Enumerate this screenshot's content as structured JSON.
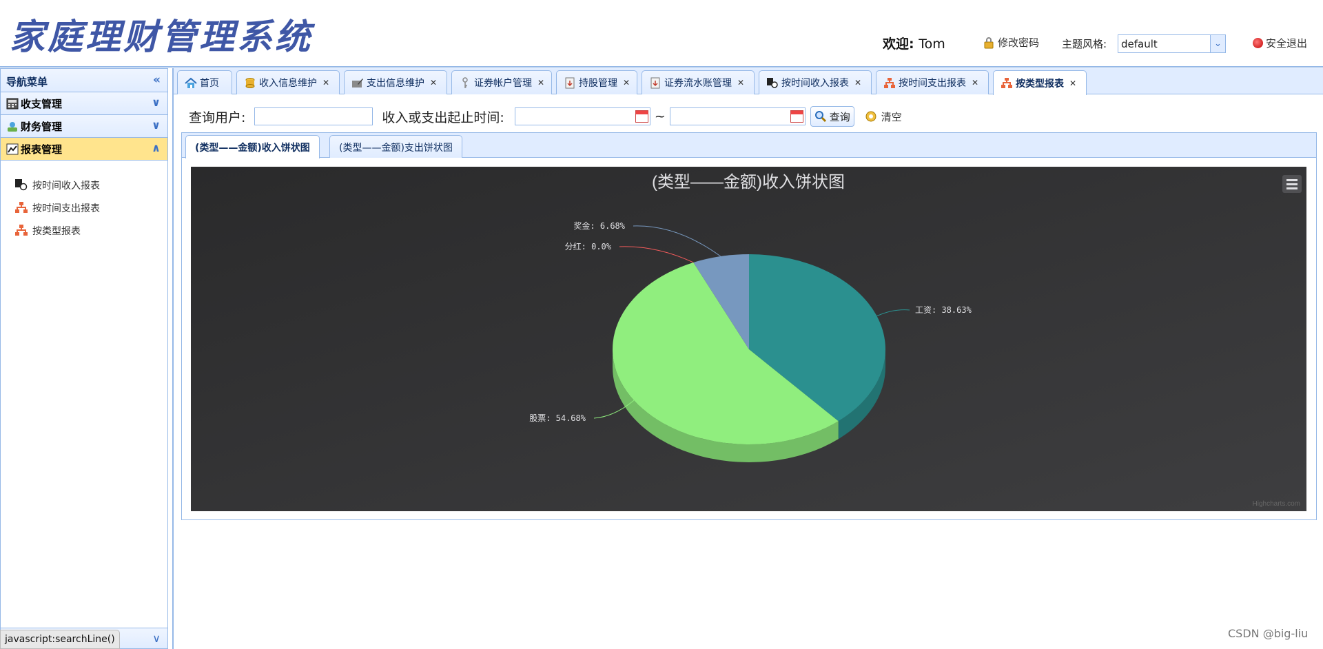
{
  "header": {
    "logo": "家庭理财管理系统",
    "welcome_label": "欢迎:",
    "welcome_user": "Tom",
    "change_password": "修改密码",
    "theme_label": "主题风格:",
    "theme_value": "default",
    "logout": "安全退出"
  },
  "sidebar": {
    "title": "导航菜单",
    "sections": [
      {
        "label": "收支管理"
      },
      {
        "label": "财务管理"
      },
      {
        "label": "报表管理"
      }
    ],
    "items": [
      {
        "label": "按时间收入报表"
      },
      {
        "label": "按时间支出报表"
      },
      {
        "label": "按类型报表"
      }
    ]
  },
  "status_bar": "javascript:searchLine()",
  "tabs": [
    {
      "label": "首页"
    },
    {
      "label": "收入信息维护"
    },
    {
      "label": "支出信息维护"
    },
    {
      "label": "证券帐户管理"
    },
    {
      "label": "持股管理"
    },
    {
      "label": "证券流水账管理"
    },
    {
      "label": "按时间收入报表"
    },
    {
      "label": "按时间支出报表"
    },
    {
      "label": "按类型报表"
    }
  ],
  "search": {
    "user_label": "查询用户:",
    "user_value": "",
    "time_label": "收入或支出起止时间:",
    "start_value": "",
    "tilde": "~",
    "end_value": "",
    "query_button": "查询",
    "clear_button": "清空"
  },
  "inner_tabs": [
    {
      "label": "(类型——金额)收入饼状图"
    },
    {
      "label": "(类型——金额)支出饼状图"
    }
  ],
  "chart_data": {
    "type": "pie",
    "title": "(类型——金额)收入饼状图",
    "credits": "Highcharts.com",
    "slices": [
      {
        "name": "工资",
        "percent": 38.63,
        "label": "工资: 38.63%",
        "color": "#2b908f"
      },
      {
        "name": "股票",
        "percent": 54.68,
        "label": "股票: 54.68%",
        "color": "#90ee7e"
      },
      {
        "name": "分红",
        "percent": 0.0,
        "label": "分红: 0.0%",
        "color": "#f45b5b"
      },
      {
        "name": "奖金",
        "percent": 6.68,
        "label": "奖金: 6.68%",
        "color": "#7798bf"
      }
    ],
    "background": "#2a2a2b"
  },
  "watermark": "CSDN @big-liu"
}
